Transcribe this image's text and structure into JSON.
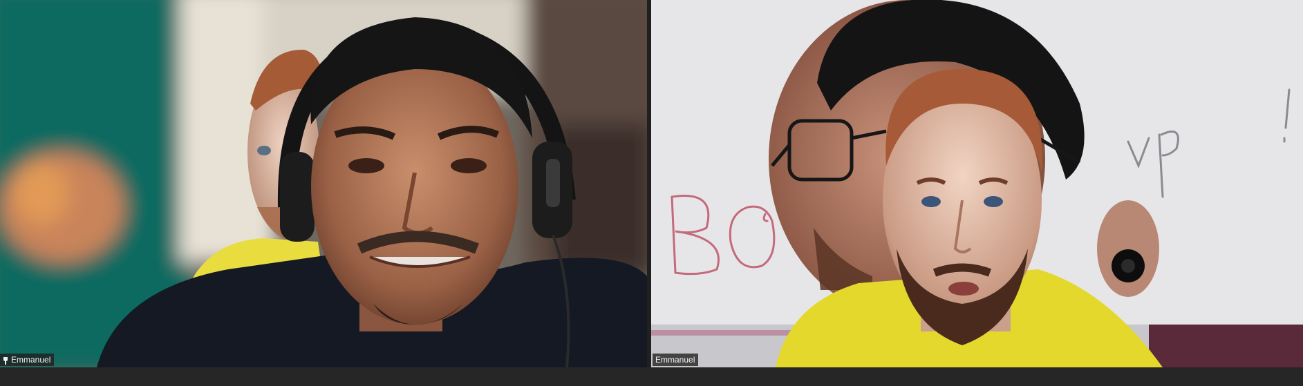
{
  "participants": [
    {
      "name": "Emmanuel",
      "has_pin_icon": true
    },
    {
      "name": "Emmanuel",
      "has_pin_icon": false
    }
  ],
  "colors": {
    "bottom_bar": "#262626",
    "divider": "#202020",
    "name_tag_bg": "#1e1e1e",
    "name_tag_text": "#f2f2f2"
  },
  "icons": {
    "left_tag_icon": "pin-icon"
  }
}
